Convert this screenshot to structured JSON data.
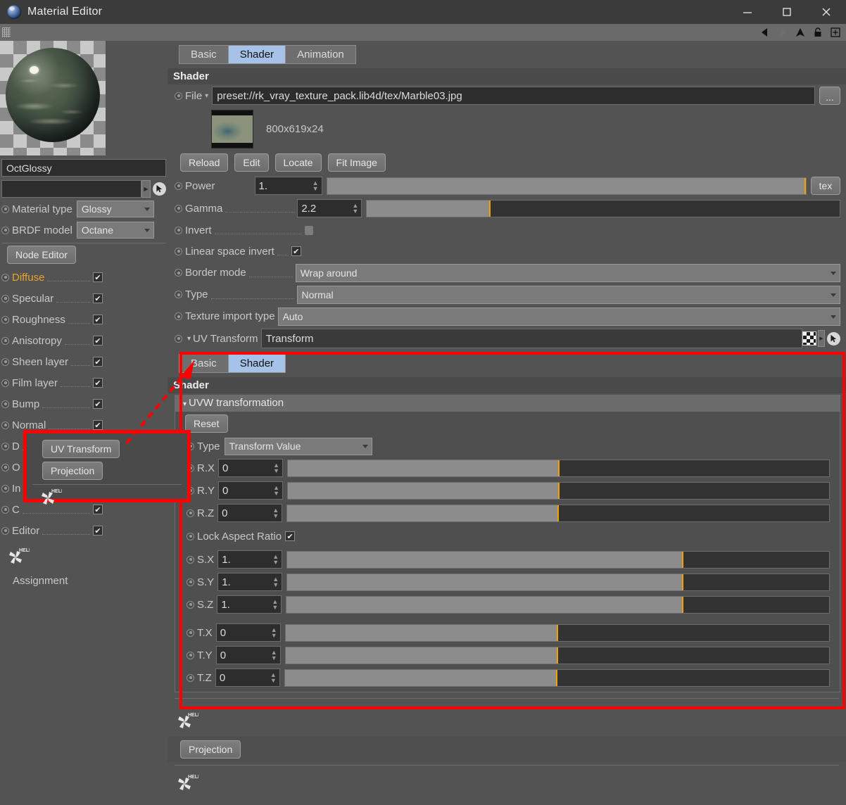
{
  "window": {
    "title": "Material Editor",
    "icon": "octane-sphere-icon",
    "minimize": "minimize-icon",
    "maximize": "maximize-icon",
    "close": "close-icon"
  },
  "toolbar": {
    "grip": "drag-grip-icon",
    "icons": [
      "back-arrow-icon",
      "forward-arrow-icon",
      "up-arrow-icon",
      "lock-icon",
      "add-icon"
    ]
  },
  "sidebar": {
    "preview_name": "material-preview-sphere",
    "material_name": "OctGlossy",
    "link_field_value": "",
    "pick_icon": "cursor-pick-icon",
    "material_type": {
      "label": "Material type",
      "value": "Glossy"
    },
    "brdf_model": {
      "label": "BRDF model",
      "value": "Octane"
    },
    "node_editor_button": "Node Editor",
    "channels": [
      {
        "label": "Diffuse",
        "checked": true,
        "highlight": true
      },
      {
        "label": "Specular",
        "checked": true,
        "highlight": false
      },
      {
        "label": "Roughness",
        "checked": true,
        "highlight": false
      },
      {
        "label": "Anisotropy",
        "checked": true,
        "highlight": false
      },
      {
        "label": "Sheen layer",
        "checked": true,
        "highlight": false
      },
      {
        "label": "Film layer",
        "checked": true,
        "highlight": false
      },
      {
        "label": "Bump",
        "checked": true,
        "highlight": false
      },
      {
        "label": "Normal",
        "checked": true,
        "highlight": false
      },
      {
        "label": "D",
        "checked": true,
        "highlight": false
      },
      {
        "label": "O",
        "checked": true,
        "highlight": false
      },
      {
        "label": "In",
        "checked": true,
        "highlight": false
      },
      {
        "label": "C",
        "checked": true,
        "highlight": false
      },
      {
        "label": "Editor",
        "checked": true,
        "highlight": false
      }
    ],
    "help_icon": "octane-help-icon",
    "assignment_label": "Assignment"
  },
  "main": {
    "tabs": [
      {
        "label": "Basic",
        "active": false
      },
      {
        "label": "Shader",
        "active": true
      },
      {
        "label": "Animation",
        "active": false
      }
    ],
    "section_title": "Shader",
    "file": {
      "label": "File",
      "value": "preset://rk_vray_texture_pack.lib4d/tex/Marble03.jpg",
      "browse_label": "...",
      "thumb_name": "texture-thumbnail",
      "dimensions": "800x619x24"
    },
    "file_buttons": [
      "Reload",
      "Edit",
      "Locate",
      "Fit Image"
    ],
    "power": {
      "label": "Power",
      "value": "1.",
      "slider_pct": 100,
      "tex_label": "tex"
    },
    "gamma": {
      "label": "Gamma",
      "value": "2.2",
      "slider_pct": 26
    },
    "invert": {
      "label": "Invert",
      "checked": false
    },
    "linear_space_invert": {
      "label": "Linear space invert",
      "checked": true
    },
    "border_mode": {
      "label": "Border mode",
      "value": "Wrap around"
    },
    "type": {
      "label": "Type",
      "value": "Normal"
    },
    "texture_import_type": {
      "label": "Texture import type",
      "value": "Auto"
    },
    "uv_transform": {
      "label": "UV Transform",
      "value": "Transform",
      "checker_icon": "checkerboard-icon",
      "expand_icon": "expand-arrow-icon",
      "pick_icon": "cursor-pick-icon"
    }
  },
  "nested": {
    "tabs": [
      {
        "label": "Basic",
        "active": false
      },
      {
        "label": "Shader",
        "active": true
      }
    ],
    "section_title": "Shader",
    "group_title": "UVW transformation",
    "reset_button": "Reset",
    "type": {
      "label": "Type",
      "value": "Transform Value"
    },
    "rotation": [
      {
        "label": "R.X",
        "value": "0",
        "slider_pct": 50
      },
      {
        "label": "R.Y",
        "value": "0",
        "slider_pct": 50
      },
      {
        "label": "R.Z",
        "value": "0",
        "slider_pct": 50
      }
    ],
    "lock_aspect_ratio": {
      "label": "Lock Aspect Ratio",
      "checked": true
    },
    "scale": [
      {
        "label": "S.X",
        "value": "1.",
        "slider_pct": 73
      },
      {
        "label": "S.Y",
        "value": "1.",
        "slider_pct": 73
      },
      {
        "label": "S.Z",
        "value": "1.",
        "slider_pct": 73
      }
    ],
    "translation": [
      {
        "label": "T.X",
        "value": "0",
        "slider_pct": 50
      },
      {
        "label": "T.Y",
        "value": "0",
        "slider_pct": 50
      },
      {
        "label": "T.Z",
        "value": "0",
        "slider_pct": 50
      }
    ],
    "help_icon": "octane-help-icon",
    "projection_button": "Projection",
    "bottom_help_icon": "octane-help-icon"
  },
  "overlay_popup": {
    "uv_transform_button": "UV Transform",
    "projection_button": "Projection",
    "help_icon": "octane-help-icon"
  },
  "colors": {
    "accent_selected_tab": "#a6c2e8",
    "highlight_channel": "#e8a32a",
    "slider_mark": "#f0a000",
    "annotation_red": "#ff0000",
    "panel_bg": "#535353",
    "field_bg": "#2d2d2d"
  }
}
